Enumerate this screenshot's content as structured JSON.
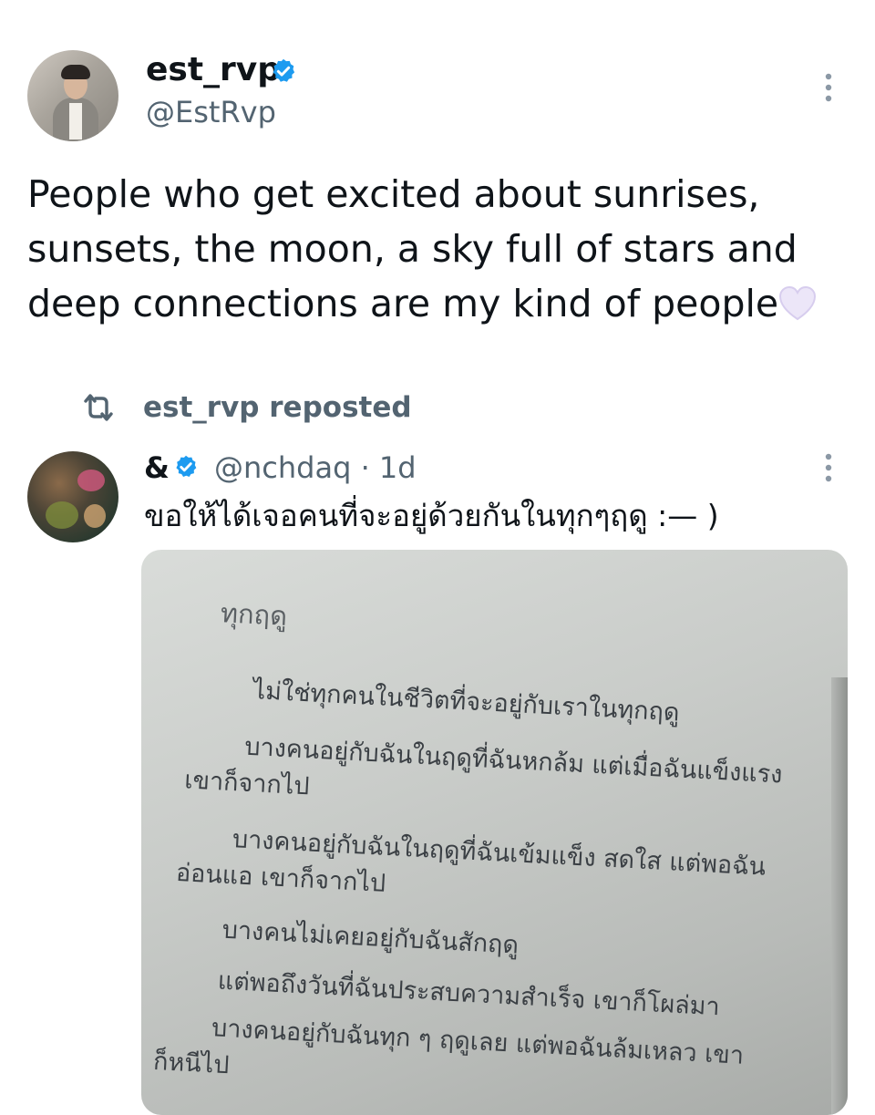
{
  "tweet1": {
    "author_name": "est_rvp",
    "handle": "@EstRvp",
    "text_lines": [
      "People who get excited about sunrises,",
      "sunsets, the moon, a sky full of stars and",
      "deep connections are my kind of people"
    ]
  },
  "repost": {
    "label": "est_rvp reposted"
  },
  "tweet2": {
    "author_name": "&",
    "handle_time": "@nchdaq · 1d",
    "text": "ขอให้ได้เจอคนที่จะอยู่ด้วยกันในทุกๆฤดู :— )",
    "photo": {
      "title": "ทุกฤดู",
      "lines": [
        "ไม่ใช่ทุกคนในชีวิตที่จะอยู่กับเราในทุกฤดู",
        "บางคนอยู่กับฉันในฤดูที่ฉันหกล้ม แต่เมื่อฉันแข็งแรง",
        "เขาก็จากไป",
        "บางคนอยู่กับฉันในฤดูที่ฉันเข้มแข็ง สดใส แต่พอฉัน",
        "อ่อนแอ เขาก็จากไป",
        "บางคนไม่เคยอยู่กับฉันสักฤดู",
        "แต่พอถึงวันที่ฉันประสบความสำเร็จ เขาก็โผล่มา",
        "บางคนอยู่กับฉันทุก ๆ ฤดูเลย แต่พอฉันล้มเหลว เขา",
        "ก็หนีไป"
      ]
    }
  },
  "colors": {
    "verified": "#1d9bf0",
    "secondary_text": "#536471",
    "primary_text": "#0f1419",
    "heart": "#e9e3f7"
  },
  "icons": {
    "verified": "verified-badge-icon",
    "more": "more-vertical-icon",
    "repost": "repost-icon",
    "heart": "white-heart-emoji-icon"
  }
}
